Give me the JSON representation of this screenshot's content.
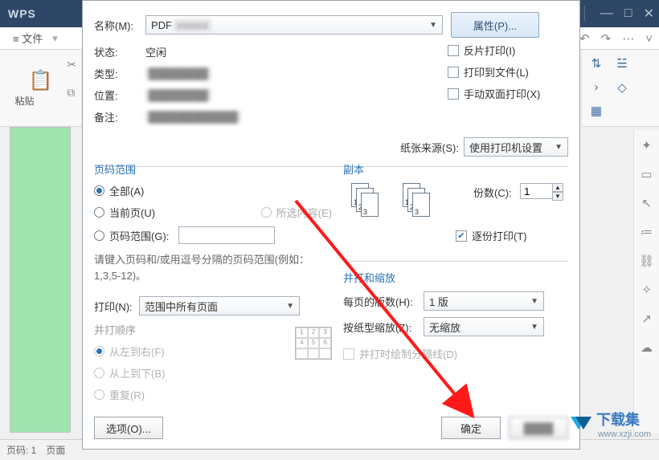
{
  "app": {
    "brand": "WPS",
    "file_menu": "≡ 文件",
    "paste_label": "粘贴",
    "statusbar_page_label": "页码: 1",
    "statusbar_page_tab": "页面"
  },
  "win": {
    "min": "—",
    "max": "□",
    "close": "✕"
  },
  "printer": {
    "name_label": "名称(M):",
    "name_value": "PDF",
    "props_button": "属性(P)...",
    "status_label": "状态:",
    "status_value": "空闲",
    "type_label": "类型:",
    "type_value": "████████",
    "where_label": "位置:",
    "where_value": "████████",
    "comment_label": "备注:",
    "comment_value": "████████████",
    "reverse_print": "反片打印(I)",
    "print_to_file": "打印到文件(L)",
    "manual_duplex": "手动双面打印(X)",
    "paper_source_label": "纸张来源(S):",
    "paper_source_value": "使用打印机设置"
  },
  "range": {
    "group_title": "页码范围",
    "all": "全部(A)",
    "current": "当前页(U)",
    "selection": "所选内容(E)",
    "range_radio": "页码范围(G):",
    "hint": "请键入页码和/或用逗号分隔的页码范围(例如：1,3,5-12)。",
    "print_label": "打印(N):",
    "print_value": "范围中所有页面",
    "order_title": "并打顺序",
    "lr": "从左到右(F)",
    "tb": "从上到下(B)",
    "repeat": "重复(R)"
  },
  "copy": {
    "group_title": "副本",
    "copies_label": "份数(C):",
    "copies_value": "1",
    "collate": "逐份打印(T)"
  },
  "scale": {
    "group_title": "并打和缩放",
    "per_sheet_label": "每页的版数(H):",
    "per_sheet_value": "1 版",
    "fit_label": "按纸型缩放(Z):",
    "fit_value": "无缩放",
    "draw_border": "并打时绘制分隔线(D)"
  },
  "buttons": {
    "options": "选项(O)...",
    "ok": "确定"
  },
  "watermark": {
    "name": "下载集",
    "url": "www.xzji.com"
  }
}
